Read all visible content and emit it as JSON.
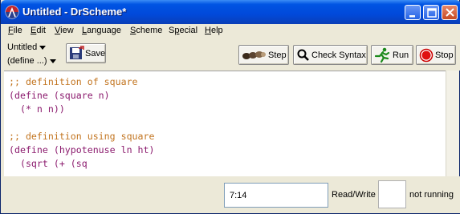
{
  "window": {
    "title": "Untitled - DrScheme*"
  },
  "menu": {
    "items": [
      {
        "label": "File",
        "key": "F",
        "rest": "ile"
      },
      {
        "label": "Edit",
        "key": "E",
        "rest": "dit"
      },
      {
        "label": "View",
        "key": "V",
        "rest": "iew"
      },
      {
        "label": "Language",
        "key": "L",
        "rest": "anguage"
      },
      {
        "label": "Scheme",
        "key": "S",
        "rest": "cheme"
      },
      {
        "label": "Special",
        "key": "p",
        "pre": "S",
        "rest": "ecial"
      },
      {
        "label": "Help",
        "key": "H",
        "rest": "elp"
      }
    ]
  },
  "toolbar": {
    "file_dropdown": "Untitled",
    "define_dropdown": "(define ...)",
    "save_label": "Save",
    "step_label": "Step",
    "check_syntax_label": "Check Syntax",
    "run_label": "Run",
    "stop_label": "Stop"
  },
  "editor": {
    "lines": [
      ";; definition of square",
      "(define (square n)",
      "  (* n n))",
      "",
      ";; definition using square",
      "(define (hypotenuse ln ht)",
      "  (sqrt (+ (sq"
    ]
  },
  "status": {
    "position": "7:14",
    "mode": "Read/Write",
    "running": "not running"
  },
  "colors": {
    "comment": "#c2741f",
    "code": "#8b1a6d",
    "titlebar": "#0054e3",
    "chrome": "#ece9d8"
  }
}
